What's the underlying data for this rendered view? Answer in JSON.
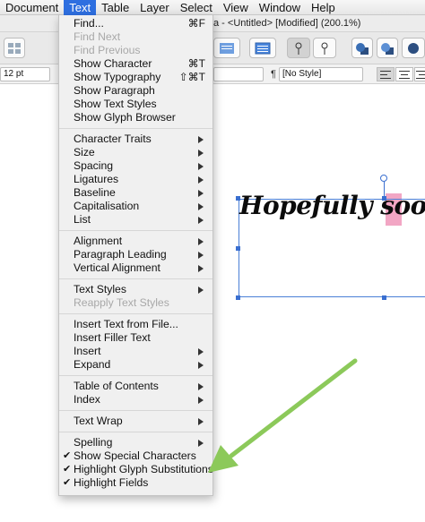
{
  "menubar": {
    "items": [
      {
        "label": "Document"
      },
      {
        "label": "Text"
      },
      {
        "label": "Table"
      },
      {
        "label": "Layer"
      },
      {
        "label": "Select"
      },
      {
        "label": "View"
      },
      {
        "label": "Window"
      },
      {
        "label": "Help"
      }
    ]
  },
  "window": {
    "title": "a - <Untitled> [Modified] (200.1%)"
  },
  "context_bar": {
    "font_size": "12 pt",
    "paragraph_style": "[No Style]"
  },
  "canvas": {
    "sample_text": "Hopefully soon",
    "highlight_color": "#f2a6c4",
    "selection_color": "#4a7fd6"
  },
  "text_menu": {
    "groups": [
      [
        {
          "label": "Find...",
          "shortcut": "⌘F",
          "disabled": false
        },
        {
          "label": "Find Next",
          "disabled": true
        },
        {
          "label": "Find Previous",
          "disabled": true
        },
        {
          "label": "Show Character",
          "shortcut": "⌘T",
          "disabled": false
        },
        {
          "label": "Show Typography",
          "shortcut": "⇧⌘T",
          "disabled": false
        },
        {
          "label": "Show Paragraph",
          "disabled": false
        },
        {
          "label": "Show Text Styles",
          "disabled": false
        },
        {
          "label": "Show Glyph Browser",
          "disabled": false
        }
      ],
      [
        {
          "label": "Character Traits",
          "submenu": true
        },
        {
          "label": "Size",
          "submenu": true
        },
        {
          "label": "Spacing",
          "submenu": true
        },
        {
          "label": "Ligatures",
          "submenu": true
        },
        {
          "label": "Baseline",
          "submenu": true
        },
        {
          "label": "Capitalisation",
          "submenu": true
        },
        {
          "label": "List",
          "submenu": true
        }
      ],
      [
        {
          "label": "Alignment",
          "submenu": true
        },
        {
          "label": "Paragraph Leading",
          "submenu": true
        },
        {
          "label": "Vertical Alignment",
          "submenu": true
        }
      ],
      [
        {
          "label": "Text Styles",
          "submenu": true
        },
        {
          "label": "Reapply Text Styles",
          "disabled": true
        }
      ],
      [
        {
          "label": "Insert Text from File..."
        },
        {
          "label": "Insert Filler Text"
        },
        {
          "label": "Insert",
          "submenu": true
        },
        {
          "label": "Expand",
          "submenu": true
        }
      ],
      [
        {
          "label": "Table of Contents",
          "submenu": true
        },
        {
          "label": "Index",
          "submenu": true
        }
      ],
      [
        {
          "label": "Text Wrap",
          "submenu": true
        }
      ],
      [
        {
          "label": "Spelling",
          "submenu": true
        },
        {
          "label": "Show Special Characters",
          "checked": true
        },
        {
          "label": "Highlight Glyph Substitutions",
          "checked": true
        },
        {
          "label": "Highlight Fields",
          "checked": true
        }
      ]
    ]
  },
  "annotation": {
    "arrow_color": "#8cc95a"
  }
}
